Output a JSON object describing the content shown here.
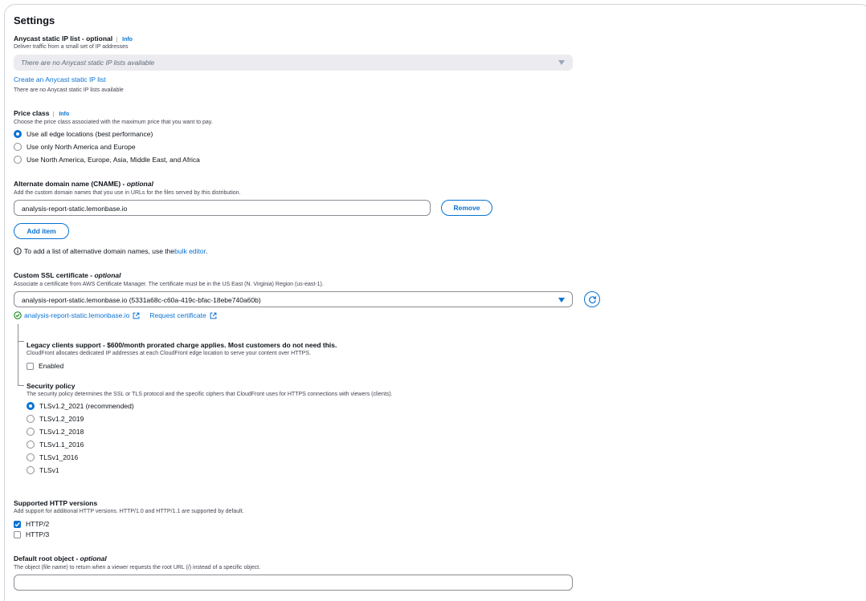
{
  "settings": {
    "title": "Settings",
    "anycast": {
      "label": "Anycast static IP list - optional",
      "info": "Info",
      "desc": "Deliver traffic from a small set of IP addresses",
      "select_value": "There are no Anycast static IP lists available",
      "create_link": "Create an Anycast static IP list",
      "note": "There are no Anycast static IP lists available"
    },
    "price_class": {
      "label": "Price class",
      "info": "Info",
      "desc": "Choose the price class associated with the maximum price that you want to pay.",
      "options": [
        {
          "label": "Use all edge locations (best performance)",
          "selected": true
        },
        {
          "label": "Use only North America and Europe",
          "selected": false
        },
        {
          "label": "Use North America, Europe, Asia, Middle East, and Africa",
          "selected": false
        }
      ]
    },
    "cname": {
      "label": "Alternate domain name (CNAME) - ",
      "label_opt": "optional",
      "desc": "Add the custom domain names that you use in URLs for the files served by this distribution.",
      "value": "analysis-report-static.lemonbase.io",
      "remove_label": "Remove",
      "add_label": "Add item",
      "hint_prefix": "To add a list of alternative domain names, use the ",
      "hint_link": "bulk editor",
      "hint_suffix": "."
    },
    "ssl": {
      "label": "Custom SSL certificate - ",
      "label_opt": "optional",
      "desc": "Associate a certificate from AWS Certificate Manager. The certificate must be in the US East (N. Virginia) Region (us-east-1).",
      "value": "analysis-report-static.lemonbase.io (5331a68c-c60a-419c-bfac-18ebe740a60b)",
      "status_link": "analysis-report-static.lemonbase.io",
      "request_link": "Request certificate"
    },
    "legacy": {
      "label": "Legacy clients support - $600/month prorated charge applies. Most customers do not need this.",
      "desc": "CloudFront allocates dedicated IP addresses at each CloudFront edge location to serve your content over HTTPS.",
      "checkbox_label": "Enabled",
      "checked": false
    },
    "security_policy": {
      "label": "Security policy",
      "desc": "The security policy determines the SSL or TLS protocol and the specific ciphers that CloudFront uses for HTTPS connections with viewers (clients).",
      "options": [
        {
          "label": "TLSv1.2_2021 (recommended)",
          "selected": true
        },
        {
          "label": "TLSv1.2_2019",
          "selected": false
        },
        {
          "label": "TLSv1.2_2018",
          "selected": false
        },
        {
          "label": "TLSv1.1_2016",
          "selected": false
        },
        {
          "label": "TLSv1_2016",
          "selected": false
        },
        {
          "label": "TLSv1",
          "selected": false
        }
      ]
    },
    "http_versions": {
      "label": "Supported HTTP versions",
      "desc": "Add support for additional HTTP versions. HTTP/1.0 and HTTP/1.1 are supported by default.",
      "options": [
        {
          "label": "HTTP/2",
          "checked": true
        },
        {
          "label": "HTTP/3",
          "checked": false
        }
      ]
    },
    "root_object": {
      "label": "Default root object - ",
      "label_opt": "optional",
      "desc": "The object (file name) to return when a viewer requests the root URL (/) instead of a specific object.",
      "value": ""
    }
  },
  "colors": {
    "accent": "#0972d3",
    "text": "#0f141a",
    "muted": "#424650",
    "success": "#037f0c"
  },
  "icons": [
    "dropdown-caret-icon",
    "refresh-icon",
    "success-check-icon",
    "external-link-icon",
    "info-circle-icon",
    "checkmark-icon"
  ]
}
